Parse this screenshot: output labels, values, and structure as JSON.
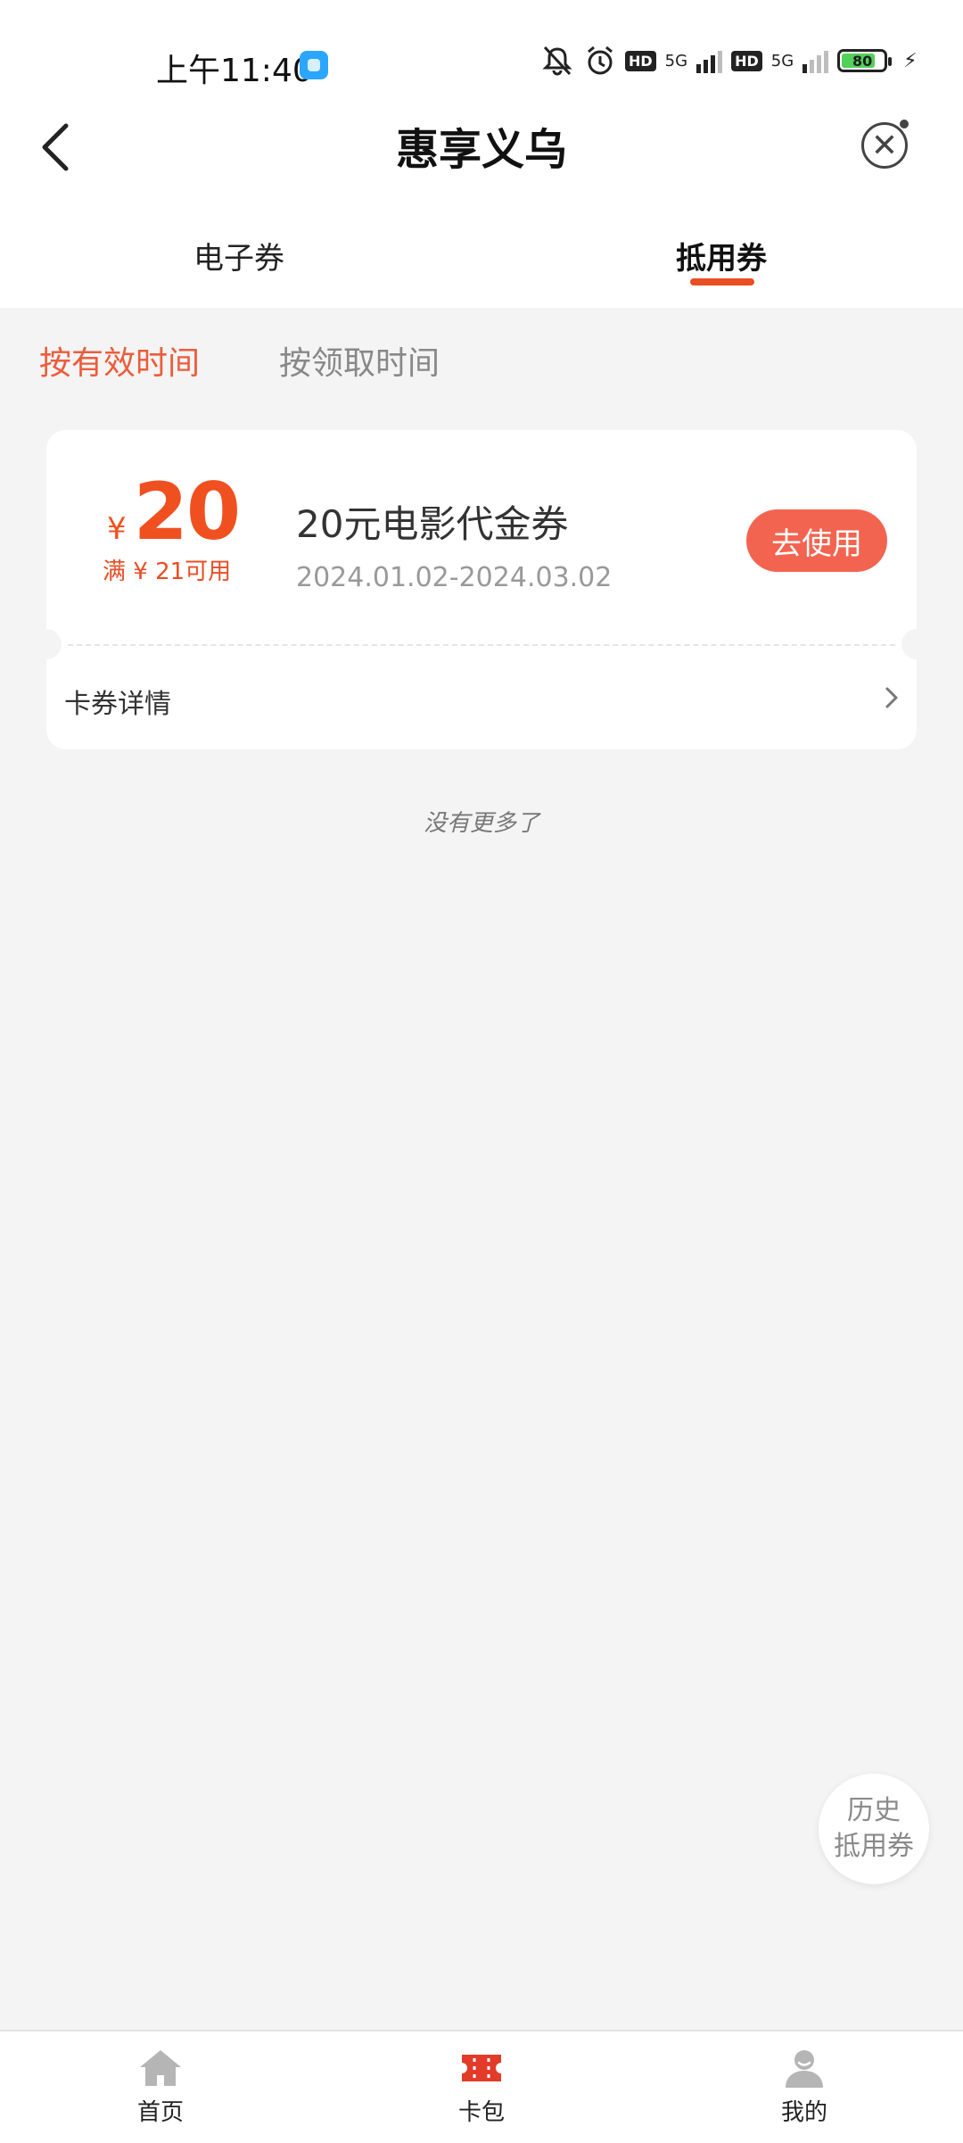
{
  "status_bar": {
    "time": "上午11:40",
    "hd1": "HD",
    "net1": "5G",
    "hd2": "HD",
    "net2": "5G",
    "battery": "80",
    "battery_level": 0.8
  },
  "header": {
    "title": "惠享义乌"
  },
  "tabs": [
    {
      "label": "电子券"
    },
    {
      "label": "抵用券"
    }
  ],
  "active_tab": 1,
  "sort": {
    "options": [
      {
        "label": "按有效时间"
      },
      {
        "label": "按领取时间"
      }
    ]
  },
  "coupon": {
    "currency": "¥",
    "amount": "20",
    "condition": "满 ¥ 21可用",
    "title": "20元电影代金券",
    "date_range": "2024.01.02-2024.03.02",
    "use_label": "去使用",
    "detail_label": "卡券详情"
  },
  "list_end_text": "没有更多了",
  "history": {
    "line1": "历史",
    "line2": "抵用券"
  },
  "bottom_nav": [
    {
      "label": "首页",
      "icon": "home-icon"
    },
    {
      "label": "卡包",
      "icon": "ticket-icon"
    },
    {
      "label": "我的",
      "icon": "user-icon"
    }
  ],
  "colors": {
    "accent": "#ea4d22",
    "button": "#f36450",
    "nav_active": "#e23b2a",
    "nav_inactive": "#b5b5b5"
  }
}
